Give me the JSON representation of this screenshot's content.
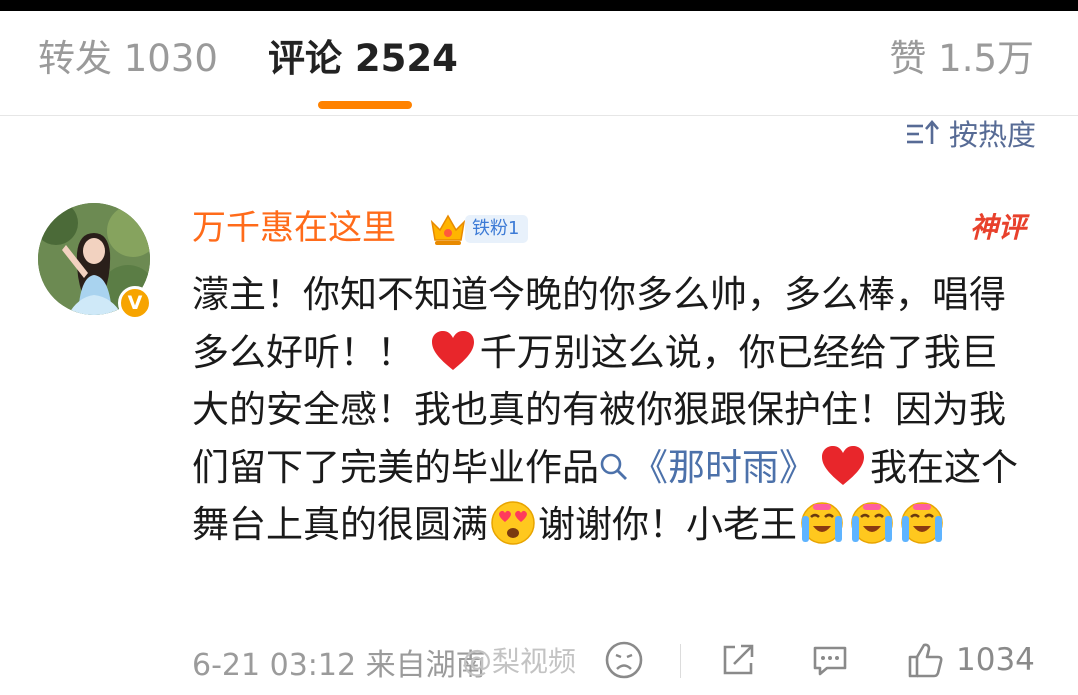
{
  "tabs": {
    "repost": "转发 1030",
    "comments": "评论 2524",
    "likes": "赞 1.5万"
  },
  "sort": {
    "label": "按热度",
    "icon": "sort-icon"
  },
  "comment": {
    "username": "万千惠在这里",
    "fan_badge": "铁粉1",
    "hot_tag": "神评",
    "text": {
      "p1": "濛主！你知不知道今晚的你多么帅，多么棒，唱得多么好听！！",
      "p2": "千万别这么说，你已经给了我巨大的安全感！我也真的有被你狠跟保护住！因为我们留下了完美的毕业作品",
      "link": "《那时雨》",
      "p3": "我在这个舞台上真的很圆满",
      "p4": "谢谢你！小老王"
    },
    "meta": "6-21 03:12  来自湖南",
    "like_count": "1034"
  },
  "watermark": {
    "at": "@",
    "text": "梨视频"
  },
  "colors": {
    "accent": "#ff8200",
    "username": "#ff6b1a",
    "link": "#4c71aa",
    "hot": "#e8412c"
  }
}
